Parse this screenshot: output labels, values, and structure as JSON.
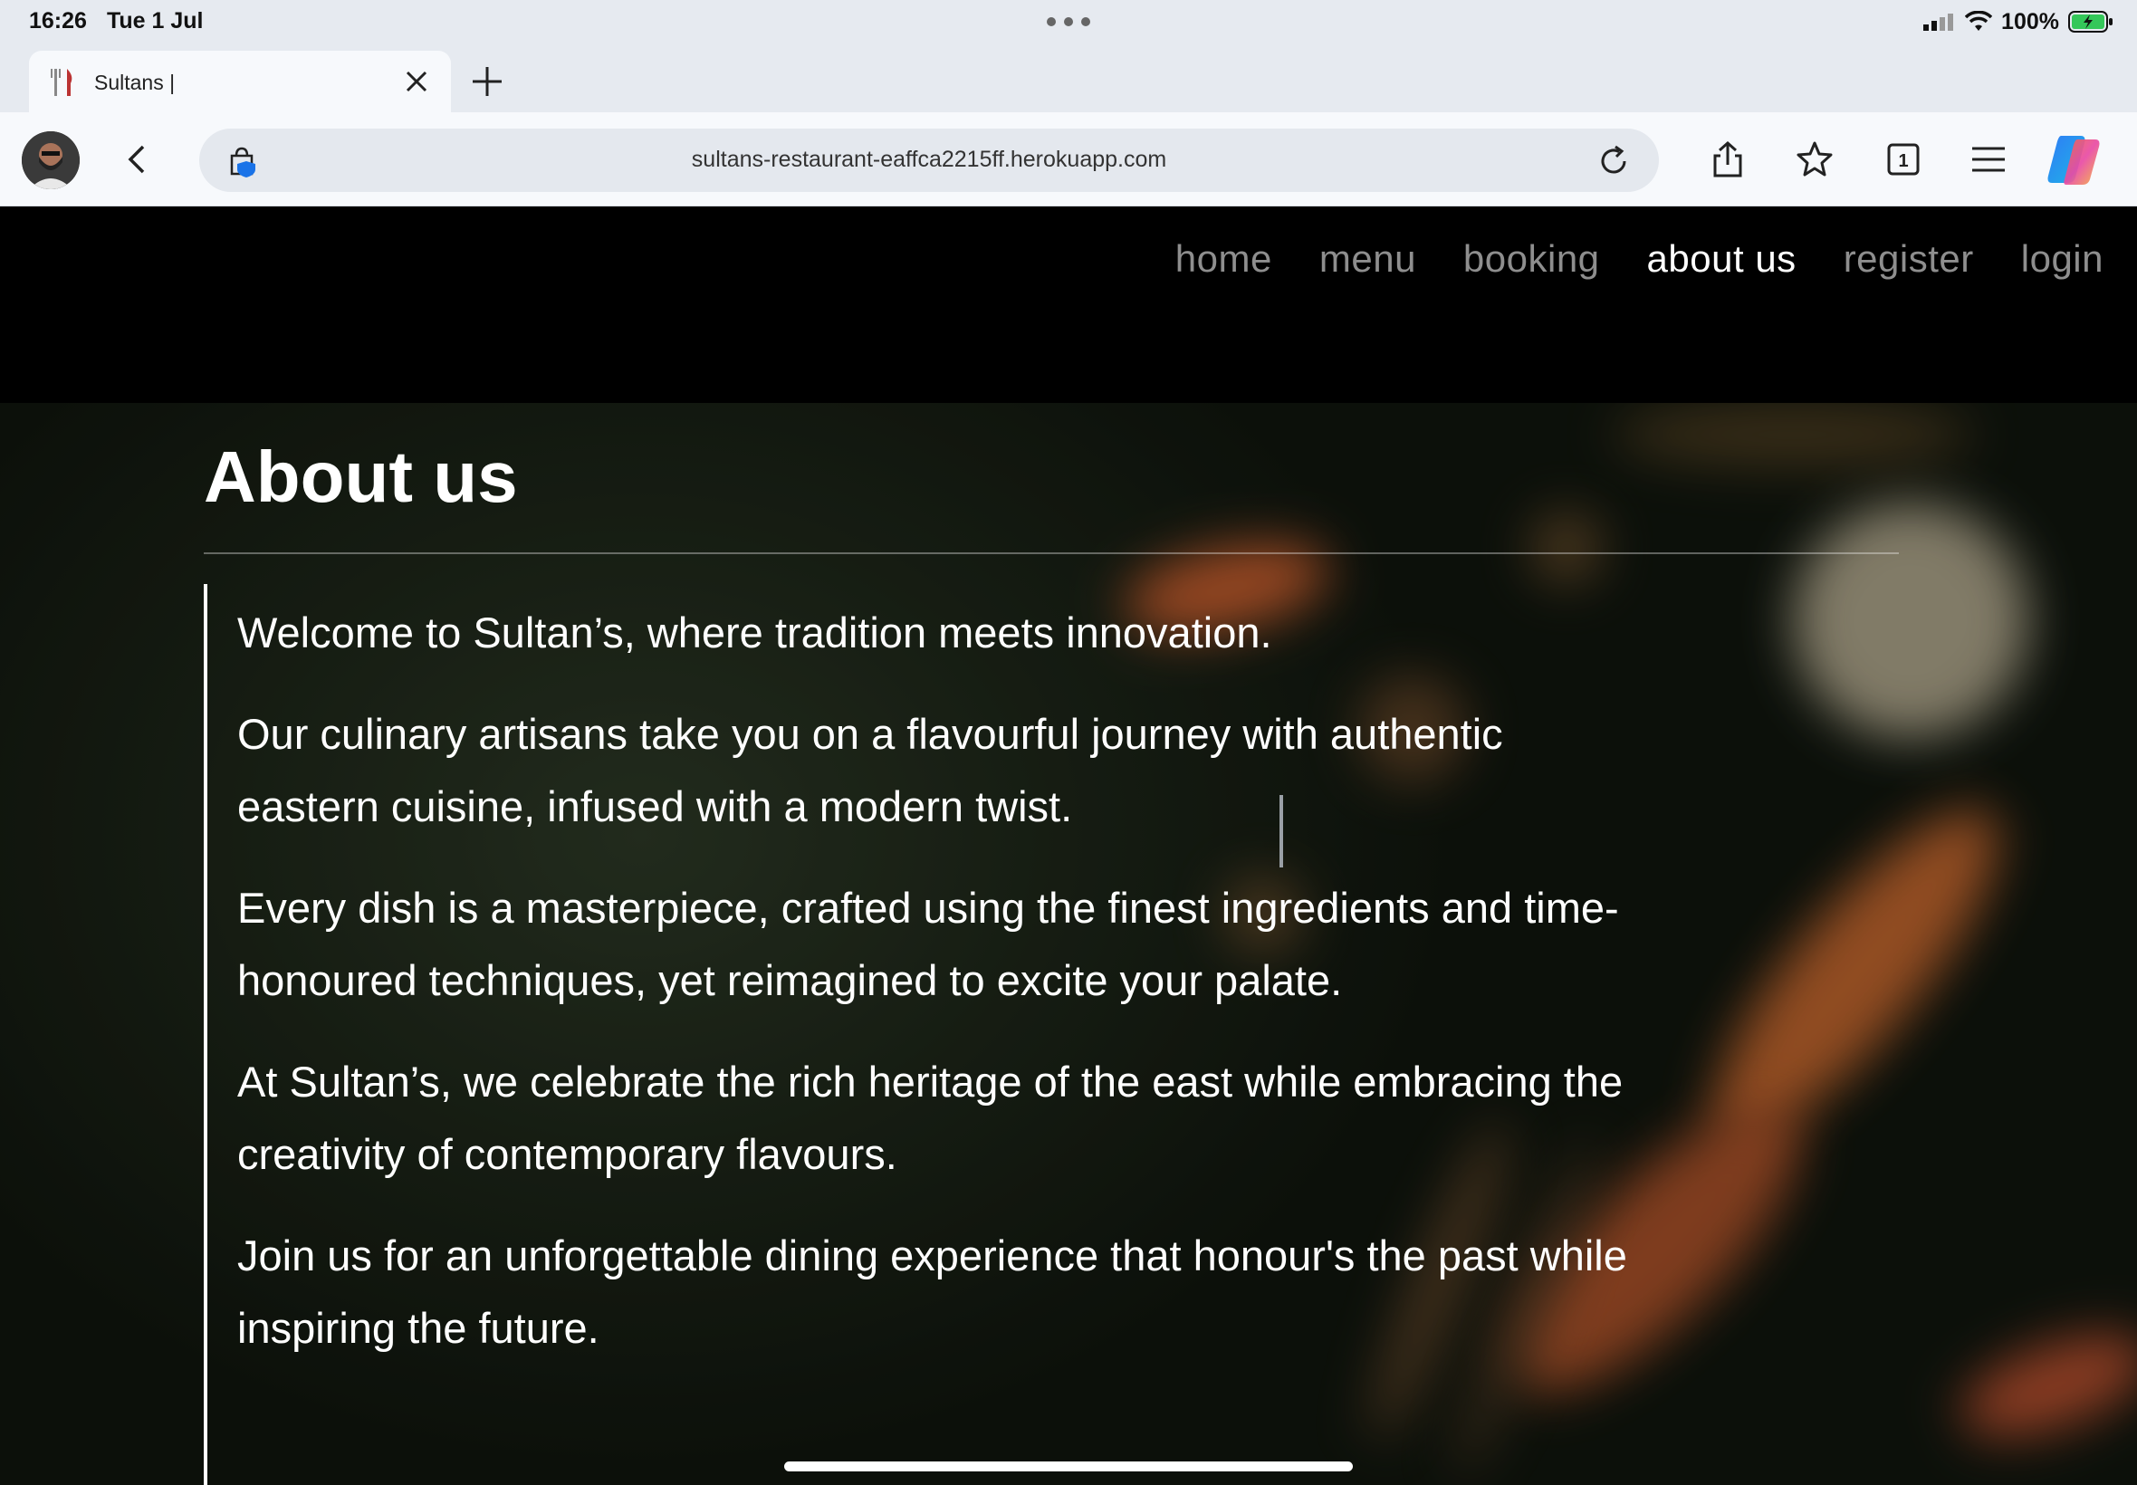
{
  "status_bar": {
    "time": "16:26",
    "date": "Tue 1 Jul",
    "battery": "100%"
  },
  "browser": {
    "tab_title": "Sultans |",
    "url": "sultans-restaurant-eaffca2215ff.herokuapp.com",
    "tab_count": "1",
    "icons": [
      "fork-knife-icon",
      "close-icon",
      "plus-icon",
      "back-icon",
      "shield-bag-icon",
      "reload-icon",
      "share-icon",
      "star-icon",
      "tabs-icon",
      "menu-icon",
      "copilot-icon"
    ]
  },
  "nav": {
    "links": [
      "home",
      "menu",
      "booking",
      "about us",
      "register",
      "login"
    ],
    "active": "about us"
  },
  "about": {
    "title": "About us",
    "paragraphs": [
      "Welcome to Sultan’s, where tradition meets innovation.",
      "Our culinary artisans take you on a flavourful journey with authentic eastern cuisine, infused with a modern twist.",
      "Every dish is a masterpiece, crafted using the finest ingredients and time-honoured techniques, yet reimagined to excite your palate.",
      "At Sultan’s, we celebrate the rich heritage of the east while embracing the creativity of contemporary flavours.",
      "Join us for an unforgettable dining experience that honour's the past while inspiring the future."
    ]
  },
  "colors": {
    "nav_bg": "#000000",
    "nav_link": "#8e8e8e",
    "nav_active": "#ffffff",
    "text": "#ffffff"
  }
}
